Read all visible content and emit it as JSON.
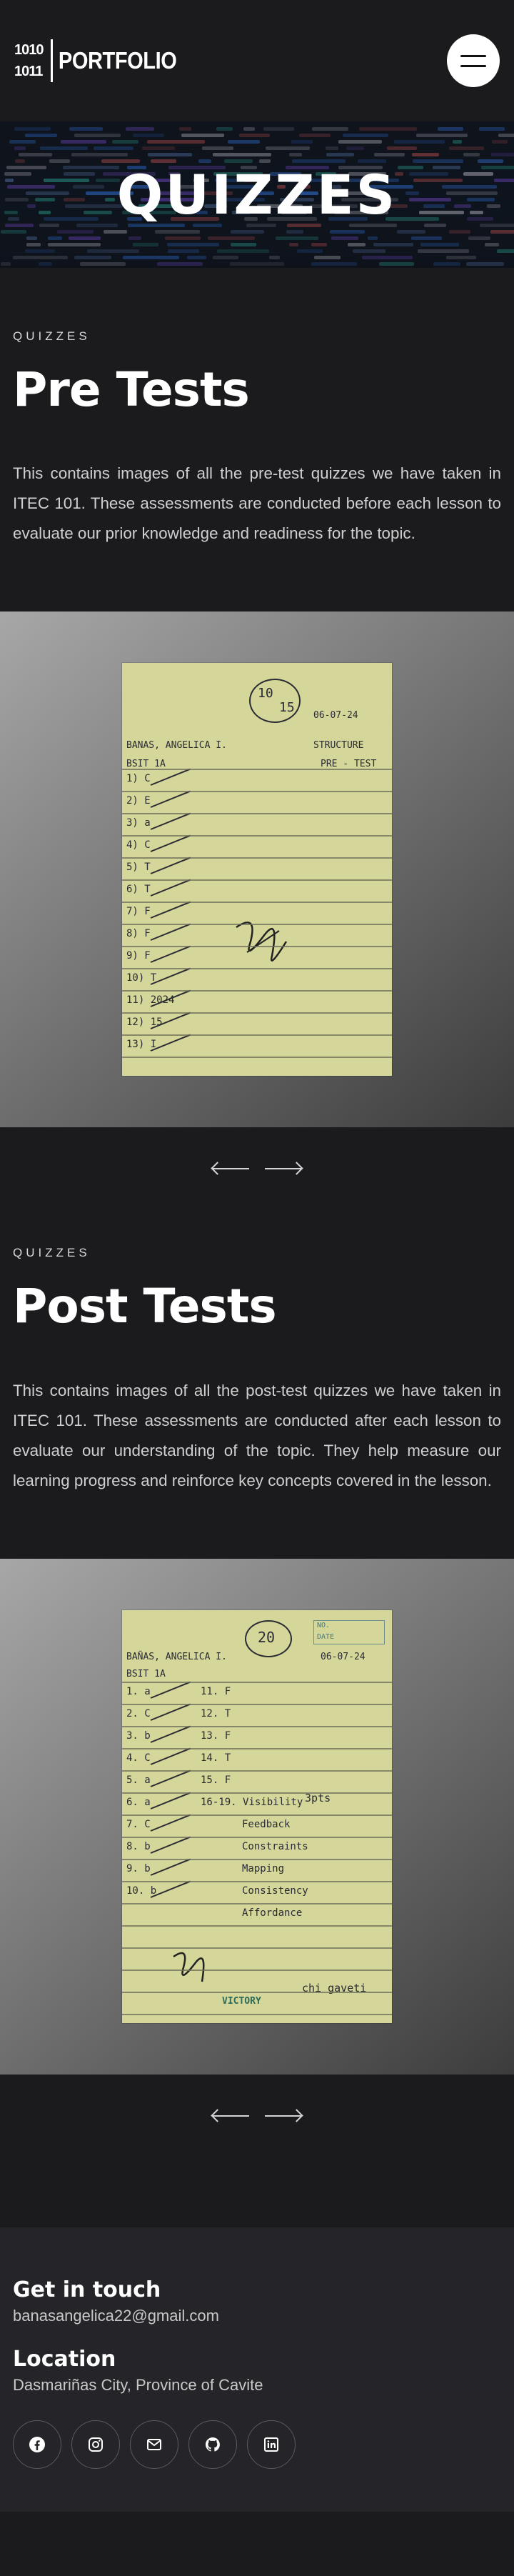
{
  "header": {
    "logo_bits_top": "1010",
    "logo_bits_bottom": "1011",
    "logo_text": "PORTFOLIO"
  },
  "hero": {
    "title": "QUIZZES"
  },
  "pre": {
    "eyebrow": "QUIZZES",
    "title": "Pre Tests",
    "description": "This contains images of all the pre-test quizzes we have taken in ITEC 101. These assessments are conducted before each lesson to evaluate our prior knowledge and readiness for the topic.",
    "paper": {
      "score_top": "10",
      "score_bottom": "15",
      "date": "06-07-24",
      "name": "BANAS, ANGELICA I.",
      "section": "BSIT 1A",
      "subject": "STRUCTURE",
      "type": "PRE - TEST",
      "answers": [
        "1) C",
        "2) E",
        "3) a",
        "4) C",
        "5) T",
        "6) T",
        "7) F",
        "8) F",
        "9) F",
        "10) T",
        "11) 2024",
        "12) 15",
        "13) I"
      ],
      "extra": "2024"
    }
  },
  "post": {
    "eyebrow": "QUIZZES",
    "title": "Post Tests",
    "description": "This contains images of all the post-test quizzes we have taken in ITEC 101. These assessments are conducted after each lesson to evaluate our understanding of the topic. They help measure our learning progress and reinforce key concepts covered in the lesson.",
    "paper": {
      "score": "20",
      "no_label": "NO.",
      "date_label": "DATE",
      "date": "06-07-24",
      "name": "BAÑAS, ANGELICA I.",
      "section": "BSIT 1A",
      "answers_left": [
        "1. a",
        "2. C",
        "3. b",
        "4. C",
        "5. a",
        "6. a",
        "7. C",
        "8. b",
        "9. b",
        "10. b"
      ],
      "answers_right": [
        "11. F",
        "12. T",
        "13. F",
        "14. T",
        "15. F",
        "16-19. Visibility",
        "Feedback",
        "Constraints",
        "Mapping",
        "Consistency",
        "Affordance"
      ],
      "bonus": "3pts",
      "footer_brand": "VICTORY",
      "signature_note": "chi gaveti"
    }
  },
  "footer": {
    "contact_title": "Get in touch",
    "email": "banasangelica22@gmail.com",
    "location_title": "Location",
    "location": "Dasmariñas City, Province of Cavite",
    "socials": [
      "facebook-icon",
      "instagram-icon",
      "mail-icon",
      "github-icon",
      "linkedin-icon"
    ]
  }
}
